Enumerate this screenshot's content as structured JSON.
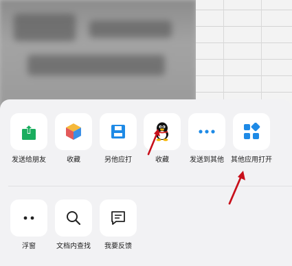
{
  "share_sheet": {
    "apps": [
      {
        "label": "发送给朋友",
        "icon": "share-upload-icon"
      },
      {
        "label": "收藏",
        "icon": "favorite-cube-icon"
      },
      {
        "label": "另他应打",
        "icon": "save-disk-icon"
      },
      {
        "label": "收藏",
        "icon": "qq-penguin-icon"
      },
      {
        "label": "发送到其他",
        "icon": "more-dots-icon"
      },
      {
        "label": "其他应用打开",
        "icon": "other-apps-icon"
      }
    ],
    "actions": [
      {
        "label": "浮窗",
        "icon": "floating-window-icon"
      },
      {
        "label": "文档内查找",
        "icon": "search-icon"
      },
      {
        "label": "我要反馈",
        "icon": "feedback-icon"
      }
    ]
  },
  "colors": {
    "accent_green": "#1aad5e",
    "accent_blue": "#1e8ae6",
    "arrow_red": "#c8101b"
  }
}
